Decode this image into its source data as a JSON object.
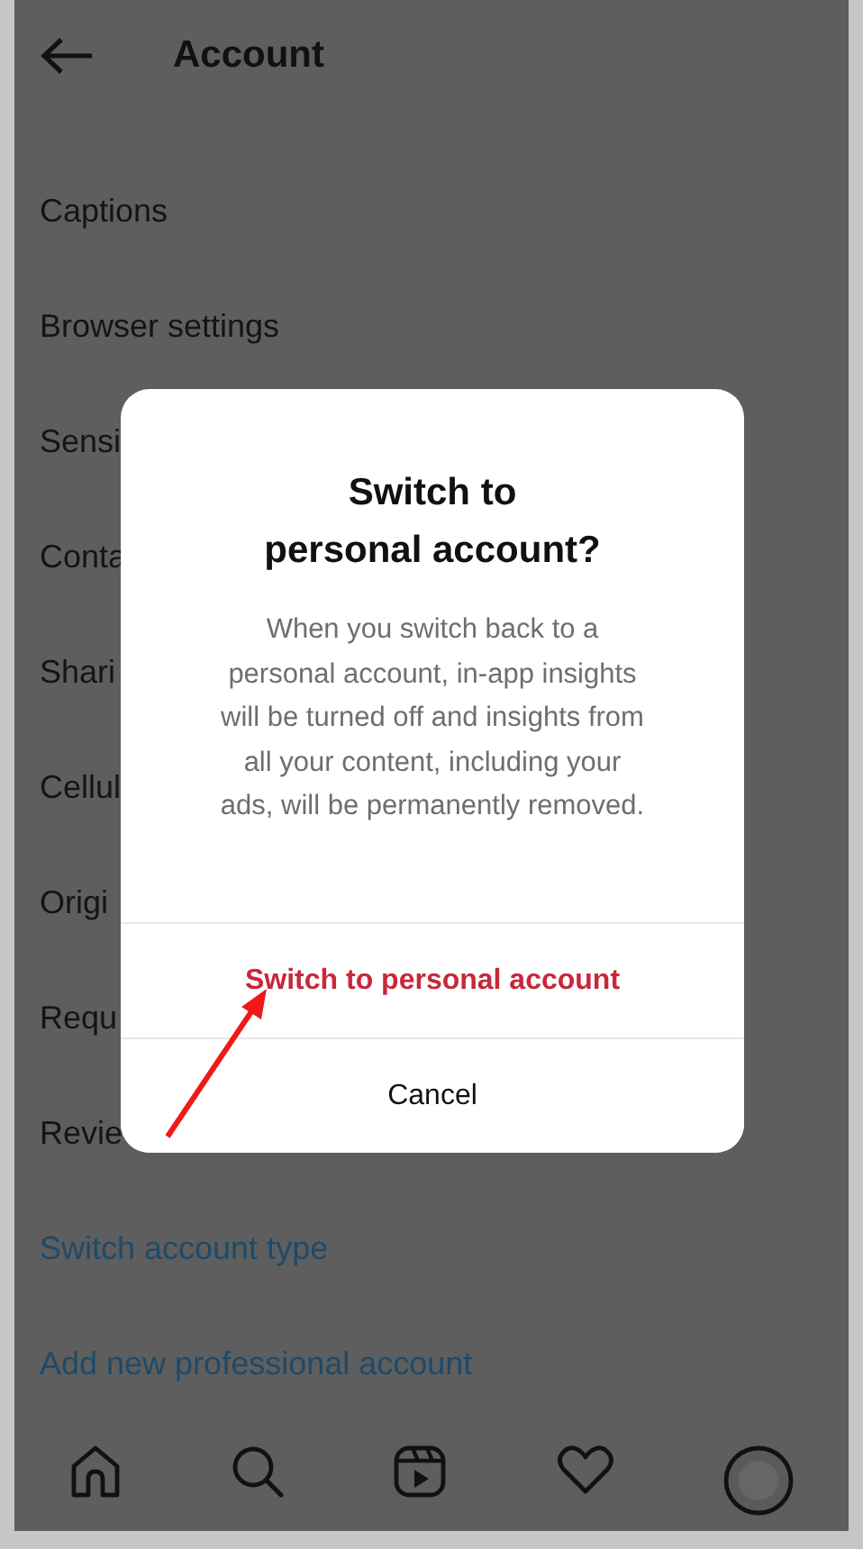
{
  "header": {
    "title": "Account"
  },
  "items": [
    {
      "kind": "setting",
      "label": "Captions"
    },
    {
      "kind": "setting",
      "label": "Browser settings"
    },
    {
      "kind": "setting",
      "label": "Sensi"
    },
    {
      "kind": "setting",
      "label": "Conta"
    },
    {
      "kind": "setting",
      "label": "Shari"
    },
    {
      "kind": "setting",
      "label": "Cellul"
    },
    {
      "kind": "setting",
      "label": "Origi"
    },
    {
      "kind": "setting",
      "label": "Requ"
    },
    {
      "kind": "setting",
      "label": "Revie"
    },
    {
      "kind": "link",
      "label": "Switch account type"
    },
    {
      "kind": "link",
      "label": "Add new professional account"
    }
  ],
  "dialog": {
    "title_lines": [
      "Switch to",
      "personal account?"
    ],
    "message": "When you switch back to a personal account, in-app insights will be turned off and insights from all your content, including your ads, will be permanently removed.",
    "actions": [
      {
        "kind": "destructive",
        "label": "Switch to personal account"
      },
      {
        "kind": "plain",
        "label": "Cancel"
      }
    ]
  },
  "nav": [
    {
      "kind": "home"
    },
    {
      "kind": "search"
    },
    {
      "kind": "reels"
    },
    {
      "kind": "heart"
    },
    {
      "kind": "profile"
    }
  ]
}
